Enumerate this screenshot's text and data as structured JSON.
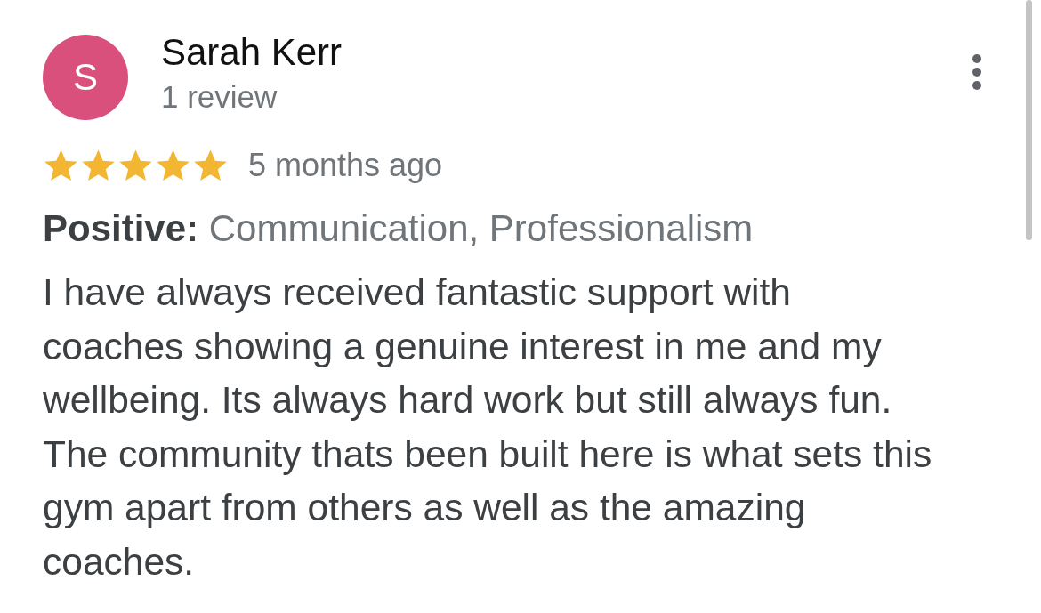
{
  "review": {
    "avatar": {
      "letter": "S",
      "color": "#d9507d"
    },
    "author": "Sarah Kerr",
    "author_meta": "1 review",
    "stars": 5,
    "time": "5 months ago",
    "highlights": "**Positive:** Communication, Professionalism",
    "text": "I have always received fantastic support with coaches showing a genuine interest in me and my wellbeing. Its always hard work but still always fun. The community thats been built here is what sets this gym apart from others as well as the amazing coaches."
  }
}
